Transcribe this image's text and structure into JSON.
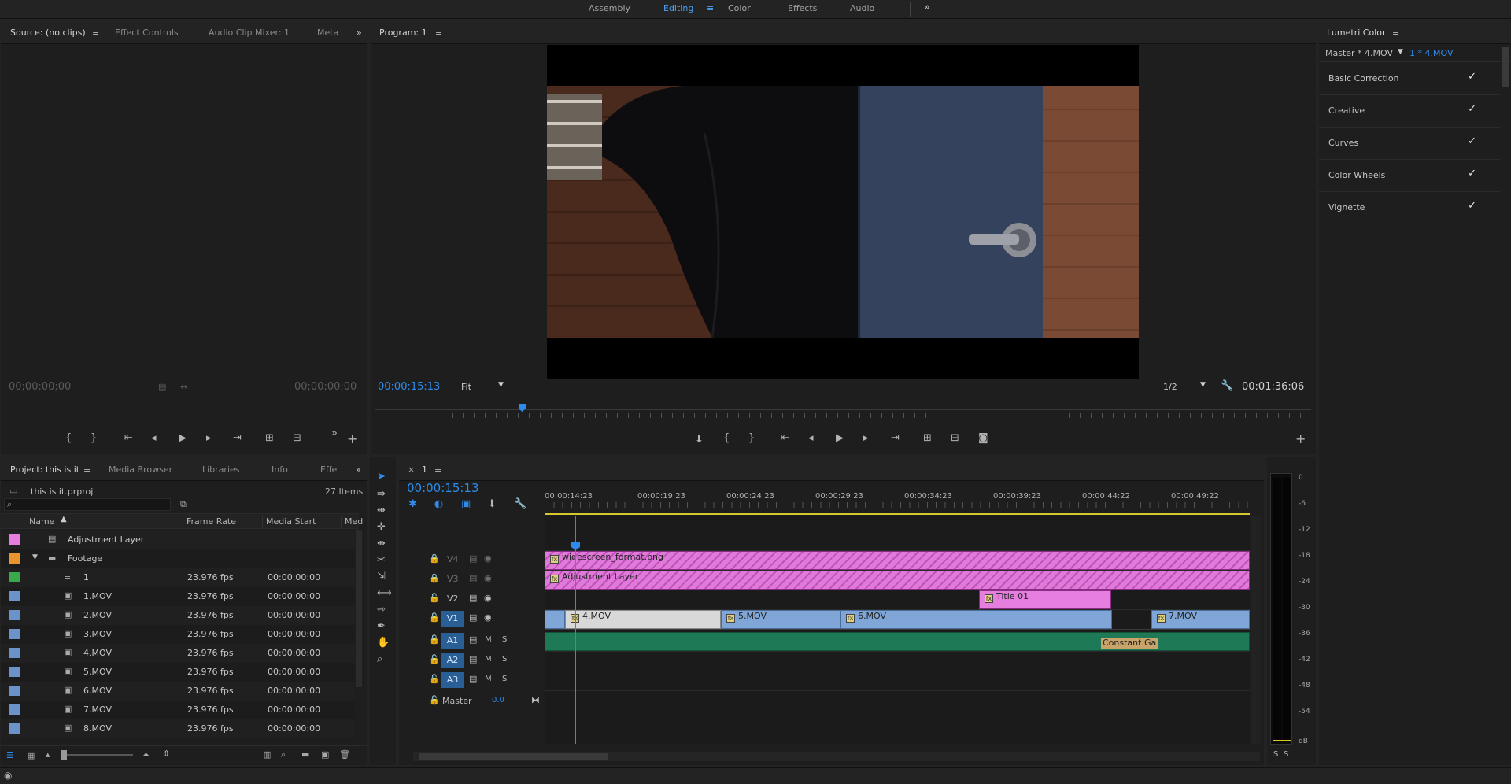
{
  "workspaces": {
    "items": [
      "Assembly",
      "Editing",
      "Color",
      "Effects",
      "Audio"
    ],
    "active": "Editing"
  },
  "source_panel": {
    "tabs": [
      "Source: (no clips)",
      "Effect Controls",
      "Audio Clip Mixer: 1",
      "Meta"
    ],
    "tc_left": "00;00;00;00",
    "tc_right": "00;00;00;00"
  },
  "program": {
    "title": "Program: 1",
    "timecode": "00:00:15:13",
    "fit": "Fit",
    "resolution": "1/2",
    "duration": "00:01:36:06"
  },
  "lumetri": {
    "title": "Lumetri Color",
    "master": "Master * 4.MOV",
    "clip": "1 * 4.MOV",
    "sections": [
      "Basic Correction",
      "Creative",
      "Curves",
      "Color Wheels",
      "Vignette"
    ],
    "check_glyph": "✓"
  },
  "project": {
    "tabs": [
      "Project: this is it",
      "Media Browser",
      "Libraries",
      "Info",
      "Effe"
    ],
    "file": "this is it.prproj",
    "count": "27 Items",
    "columns": [
      "Name",
      "Frame Rate",
      "Media Start",
      "Med"
    ],
    "rows": [
      {
        "name": "Adjustment Layer",
        "color": "#e67ee0",
        "rate": "",
        "start": ""
      },
      {
        "name": "Footage",
        "color": "#e8952f",
        "rate": "",
        "start": ""
      },
      {
        "name": "1",
        "color": "#3aa94c",
        "rate": "23.976 fps",
        "start": "00:00:00:00"
      },
      {
        "name": "1.MOV",
        "color": "#6a93c9",
        "rate": "23.976 fps",
        "start": "00:00:00:00"
      },
      {
        "name": "2.MOV",
        "color": "#6a93c9",
        "rate": "23.976 fps",
        "start": "00:00:00:00"
      },
      {
        "name": "3.MOV",
        "color": "#6a93c9",
        "rate": "23.976 fps",
        "start": "00:00:00:00"
      },
      {
        "name": "4.MOV",
        "color": "#6a93c9",
        "rate": "23.976 fps",
        "start": "00:00:00:00"
      },
      {
        "name": "5.MOV",
        "color": "#6a93c9",
        "rate": "23.976 fps",
        "start": "00:00:00:00"
      },
      {
        "name": "6.MOV",
        "color": "#6a93c9",
        "rate": "23.976 fps",
        "start": "00:00:00:00"
      },
      {
        "name": "7.MOV",
        "color": "#6a93c9",
        "rate": "23.976 fps",
        "start": "00:00:00:00"
      },
      {
        "name": "8.MOV",
        "color": "#6a93c9",
        "rate": "23.976 fps",
        "start": "00:00:00:00"
      }
    ]
  },
  "timeline": {
    "tab": "1",
    "close": "×",
    "timecode": "00:00:15:13",
    "ruler": [
      "00:00:14:23",
      "00:00:19:23",
      "00:00:24:23",
      "00:00:29:23",
      "00:00:34:23",
      "00:00:39:23",
      "00:00:44:22",
      "00:00:49:22"
    ],
    "video_tracks": [
      "V4",
      "V3",
      "V2",
      "V1"
    ],
    "audio_tracks": [
      "A1",
      "A2",
      "A3"
    ],
    "m_label": "M",
    "s_label": "S",
    "master_label": "Master",
    "master_value": "0.0",
    "clips": {
      "widescreen": "widescreen_format.png",
      "adjustment": "Adjustment Layer",
      "title": "Title 01",
      "c4": "4.MOV",
      "c5": "5.MOV",
      "c6": "6.MOV",
      "c7": "7.MOV",
      "constant_gain": "Constant Ga"
    }
  },
  "meter": {
    "scale": [
      "0",
      "-6",
      "-12",
      "-18",
      "-24",
      "-30",
      "-36",
      "-42",
      "-48",
      "-54",
      "dB"
    ],
    "solo": [
      "S",
      "S"
    ]
  }
}
